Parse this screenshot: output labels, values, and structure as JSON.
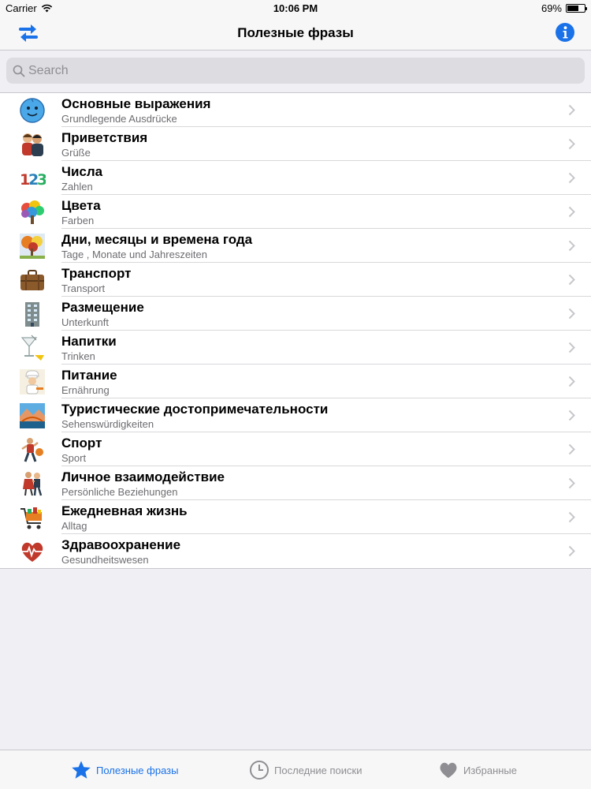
{
  "status": {
    "carrier": "Carrier",
    "time": "10:06 PM",
    "battery": "69%",
    "battery_level": 0.69
  },
  "nav": {
    "title": "Полезные фразы",
    "left_icon": "switch-language-icon",
    "right_icon": "info-icon"
  },
  "search": {
    "placeholder": "Search",
    "value": ""
  },
  "categories": [
    {
      "title": "Основные выражения",
      "subtitle": "Grundlegende Ausdrücke",
      "icon": "smiley-face-icon"
    },
    {
      "title": "Приветствия",
      "subtitle": "Grüße",
      "icon": "greeting-people-icon"
    },
    {
      "title": "Числа",
      "subtitle": "Zahlen",
      "icon": "numbers-icon"
    },
    {
      "title": "Цвета",
      "subtitle": "Farben",
      "icon": "colors-tree-icon"
    },
    {
      "title": "Дни, месяцы и времена года",
      "subtitle": "Tage , Monate und Jahreszeiten",
      "icon": "seasons-icon"
    },
    {
      "title": "Транспорт",
      "subtitle": "Transport",
      "icon": "suitcase-icon"
    },
    {
      "title": "Размещение",
      "subtitle": "Unterkunft",
      "icon": "building-icon"
    },
    {
      "title": "Напитки",
      "subtitle": "Trinken",
      "icon": "cocktail-icon"
    },
    {
      "title": "Питание",
      "subtitle": "Ernährung",
      "icon": "chef-icon"
    },
    {
      "title": "Туристические достопримечательности",
      "subtitle": "Sehenswürdigkeiten",
      "icon": "landmark-icon"
    },
    {
      "title": "Спорт",
      "subtitle": "Sport",
      "icon": "basketball-player-icon"
    },
    {
      "title": "Личное взаимодействие",
      "subtitle": "Persönliche Beziehungen",
      "icon": "dancing-couple-icon"
    },
    {
      "title": "Ежедневная жизнь",
      "subtitle": "Alltag",
      "icon": "shopping-cart-icon"
    },
    {
      "title": "Здравоохранение",
      "subtitle": "Gesundheitswesen",
      "icon": "heart-pulse-icon"
    }
  ],
  "tabs": [
    {
      "label": "Полезные фразы",
      "icon": "star-icon",
      "active": true
    },
    {
      "label": "Последние поиски",
      "icon": "clock-icon",
      "active": false
    },
    {
      "label": "Избранные",
      "icon": "heart-icon",
      "active": false
    }
  ],
  "colors": {
    "accent": "#1a72e8",
    "inactive": "#8e8e93"
  }
}
